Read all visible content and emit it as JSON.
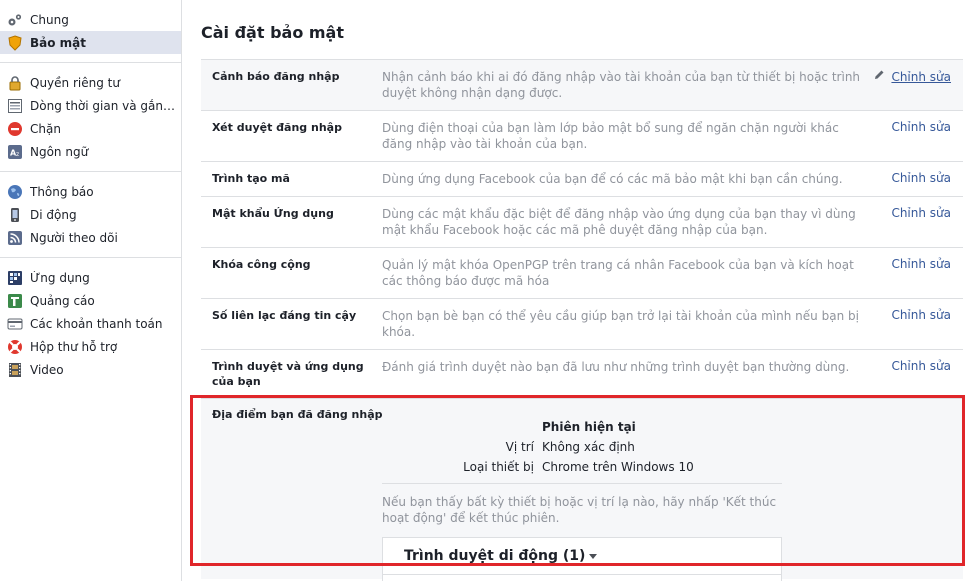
{
  "sidebar": {
    "groups": [
      [
        {
          "label": "Chung",
          "icon": "gears-icon"
        },
        {
          "label": "Bảo mật",
          "icon": "security-badge-icon",
          "active": true
        }
      ],
      [
        {
          "label": "Quyền riêng tư",
          "icon": "lock-icon"
        },
        {
          "label": "Dòng thời gian và gắn t...",
          "icon": "timeline-icon"
        },
        {
          "label": "Chặn",
          "icon": "block-icon"
        },
        {
          "label": "Ngôn ngữ",
          "icon": "language-icon"
        }
      ],
      [
        {
          "label": "Thông báo",
          "icon": "globe-icon"
        },
        {
          "label": "Di động",
          "icon": "mobile-icon"
        },
        {
          "label": "Người theo dõi",
          "icon": "rss-icon"
        }
      ],
      [
        {
          "label": "Ứng dụng",
          "icon": "apps-icon"
        },
        {
          "label": "Quảng cáo",
          "icon": "ads-icon"
        },
        {
          "label": "Các khoản thanh toán",
          "icon": "payment-card-icon"
        },
        {
          "label": "Hộp thư hỗ trợ",
          "icon": "lifebuoy-icon"
        },
        {
          "label": "Video",
          "icon": "film-icon"
        }
      ]
    ]
  },
  "main": {
    "title": "Cài đặt bảo mật",
    "edit_label": "Chỉnh sửa",
    "rows": [
      {
        "title": "Cảnh báo đăng nhập",
        "desc": "Nhận cảnh báo khi ai đó đăng nhập vào tài khoản của bạn từ thiết bị hoặc trình duyệt không nhận dạng được.",
        "highlight": true
      },
      {
        "title": "Xét duyệt đăng nhập",
        "desc": "Dùng điện thoại của bạn làm lớp bảo mật bổ sung để ngăn chặn người khác đăng nhập vào tài khoản của bạn."
      },
      {
        "title": "Trình tạo mã",
        "desc": "Dùng ứng dụng Facebook của bạn để có các mã bảo mật khi bạn cần chúng."
      },
      {
        "title": "Mật khẩu Ứng dụng",
        "desc": "Dùng các mật khẩu đặc biệt để đăng nhập vào ứng dụng của bạn thay vì dùng mật khẩu Facebook hoặc các mã phê duyệt đăng nhập của bạn."
      },
      {
        "title": "Khóa công cộng",
        "desc": "Quản lý mật khóa OpenPGP trên trang cá nhân Facebook của bạn và kích hoạt các thông báo được mã hóa"
      },
      {
        "title": "Số liên lạc đáng tin cậy",
        "desc": "Chọn bạn bè bạn có thể yêu cầu giúp bạn trở lại tài khoản của mình nếu bạn bị khóa."
      },
      {
        "title": "Trình duyệt và ứng dụng của bạn",
        "desc": "Đánh giá trình duyệt nào bạn đã lưu như những trình duyệt bạn thường dùng."
      }
    ],
    "locations": {
      "title": "Địa điểm bạn đã đăng nhập",
      "current_session_label": "Phiên hiện tại",
      "location_key": "Vị trí",
      "location_value": "Không xác định",
      "device_key": "Loại thiết bị",
      "device_value": "Chrome trên Windows 10",
      "note": "Nếu bạn thấy bất kỳ thiết bị hoặc vị trí lạ nào, hãy nhấp 'Kết thúc hoạt động' để kết thúc phiên.",
      "mobile_header": "Trình duyệt di động (1)"
    }
  },
  "colors": {
    "link": "#365899",
    "annotation": "#e0262a",
    "muted": "#90949c"
  }
}
